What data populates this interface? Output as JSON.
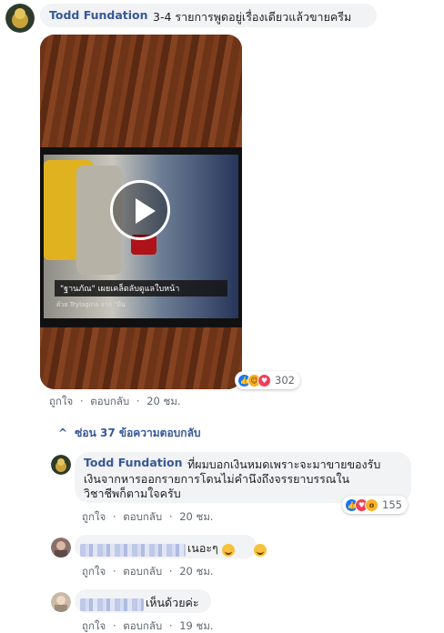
{
  "post": {
    "author": "Todd Fundation",
    "text": "3-4 รายการพูดอยู่เรื่องเดียวแล้วขายครีม",
    "video": {
      "caption_line1": "\"ฐานภัณ\" เผยเคล็ดลับดูแลใบหน้า",
      "caption_line2": "ด้วย Trylagina จาก \"มีน"
    },
    "reaction_count": "302",
    "reaction_icons": [
      "like-icon",
      "haha-icon",
      "love-icon"
    ],
    "actions": {
      "like": "ถูกใจ",
      "reply": "ตอบกลับ",
      "time": "20 ชม."
    }
  },
  "hide_replies": {
    "chevron": "^",
    "label": "ซ่อน 37 ข้อความตอบกลับ"
  },
  "replies": [
    {
      "author": "Todd Fundation",
      "line1": "ที่ผมบอกเงินหมดเพราะจะมาขายของรับ",
      "line2": "เงินจากหารออกรายการโดนไม่คำนึงถึงจรรยาบรรณใน",
      "line3": "วิชาชีพก็ตามใจครับ",
      "reaction_count": "155",
      "reaction_icons": [
        "like-icon",
        "love-icon",
        "wow-icon"
      ],
      "actions": {
        "like": "ถูกใจ",
        "reply": "ตอบกลับ",
        "time": "20 ชม."
      }
    },
    {
      "text": "เนอะๆ",
      "actions": {
        "like": "ถูกใจ",
        "reply": "ตอบกลับ",
        "time": "20 ชม."
      }
    },
    {
      "text": "เห็นด้วยค่ะ",
      "actions": {
        "like": "ถูกใจ",
        "reply": "ตอบกลับ",
        "time": "19 ชม."
      }
    }
  ],
  "separator": "·",
  "colors": {
    "link": "#385898",
    "bubble": "#f2f3f5",
    "meta": "#606770",
    "like": "#1877f2",
    "love": "#f33e58",
    "haha": "#f7b125"
  }
}
